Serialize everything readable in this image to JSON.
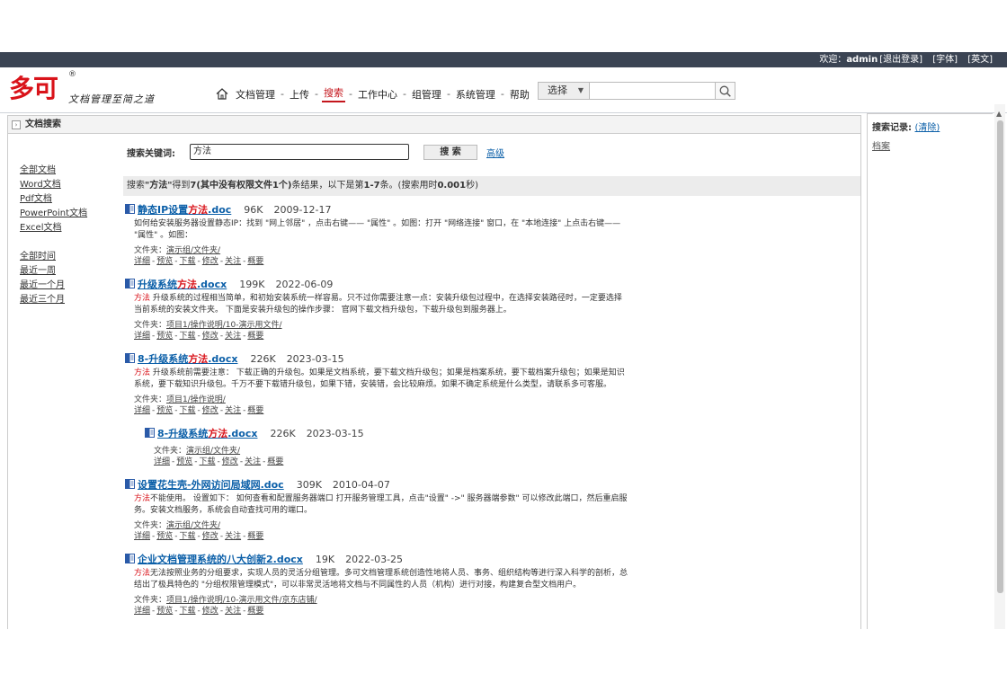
{
  "topbar": {
    "welcome": "欢迎：",
    "user": "admin",
    "logout": "[退出登录]",
    "font": "[字体]",
    "lang": "[英文]"
  },
  "logo": {
    "mark": "多可",
    "reg": "®",
    "slogan": "文档管理至简之道"
  },
  "nav": {
    "items": [
      "文档管理",
      "上传",
      "搜索",
      "工作中心",
      "组管理",
      "系统管理",
      "帮助"
    ],
    "active": "搜索"
  },
  "header_search": {
    "select_label": "选择"
  },
  "panel": {
    "title": "文档搜索"
  },
  "filters": {
    "types": [
      "全部文档",
      "Word文档",
      "Pdf文档",
      "PowerPoint文档",
      "Excel文档"
    ],
    "times": [
      "全部时间",
      "最近一周",
      "最近一个月",
      "最近三个月"
    ]
  },
  "search": {
    "label": "搜索关键词:",
    "value": "方法",
    "button": "搜 索",
    "advanced": "高级"
  },
  "summary": {
    "p1": "搜索",
    "kw": "\"方法\"",
    "p2": "得到",
    "count": "7(其中没有权限文件1个)",
    "p3": "条结果，以下是第",
    "range": "1-7",
    "p4": "条。(搜索用时",
    "time": "0.001",
    "p5": "秒)"
  },
  "results": [
    {
      "title_pre": "静态IP设置",
      "title_hl": "方法",
      "title_post": ".doc",
      "size": "96K",
      "date": "2009-12-17",
      "snippet_hl": "",
      "snippet": "如何给安装服务器设置静态IP：找到 \"网上邻居\" ，点击右键—— \"属性\" 。如图：打开 \"网络连接\" 窗口，在 \"本地连接\" 上点击右键—— \"属性\" 。如图：",
      "folder_label": "文件夹：",
      "folder": "演示组/文件夹/"
    },
    {
      "title_pre": "升级系统",
      "title_hl": "方法",
      "title_post": ".docx",
      "size": "199K",
      "date": "2022-06-09",
      "snippet_hl": "方法",
      "snippet": " 升级系统的过程相当简单，和初始安装系统一样容易。只不过你需要注意一点：安装升级包过程中，在选择安装路径时，一定要选择当前系统的安装文件夹。 下面是安装升级包的操作步骤： 官网下载文档升级包，下载升级包到服务器上。",
      "folder_label": "文件夹：",
      "folder": "项目1/操作说明/10-演示用文件/"
    },
    {
      "title_pre": "8-升级系统",
      "title_hl": "方法",
      "title_post": ".docx",
      "size": "226K",
      "date": "2023-03-15",
      "snippet_hl": "方法",
      "snippet": " 升级系统前需要注意： 下载正确的升级包。如果是文档系统，要下载文档升级包；如果是档案系统，要下载档案升级包；如果是知识系统，要下载知识升级包。千万不要下载错升级包，如果下错，安装错，会比较麻烦。如果不确定系统是什么类型，请联系多可客服。",
      "folder_label": "文件夹：",
      "folder": "项目1/操作说明/"
    },
    {
      "sub": true,
      "title_pre": "8-升级系统",
      "title_hl": "方法",
      "title_post": ".docx",
      "size": "226K",
      "date": "2023-03-15",
      "snippet_hl": "",
      "snippet": "",
      "folder_label": "文件夹：",
      "folder": "演示组/文件夹/"
    },
    {
      "title_pre": "设置花生壳-外网访问局域网.doc",
      "title_hl": "",
      "title_post": "",
      "size": "309K",
      "date": "2010-04-07",
      "snippet_hl": "方法",
      "snippet": "不能使用。 设置如下： 如何查看和配置服务器端口 打开服务管理工具，点击\"设置\" ->\" 服务器端参数\" 可以修改此端口，然后重启服务。安装文档服务，系统会自动查找可用的端口。",
      "folder_label": "文件夹：",
      "folder": "演示组/文件夹/"
    },
    {
      "title_pre": "企业文档管理系统的八大创新2.docx",
      "title_hl": "",
      "title_post": "",
      "size": "19K",
      "date": "2022-03-25",
      "snippet_hl": "方法",
      "snippet": "无法按照业务的分组要求，实现人员的灵活分组管理。多可文档管理系统创造性地将人员、事务、组织结构等进行深入科学的剖析，总结出了极具特色的 \"分组权限管理模式\"，可以非常灵活地将文档与不同属性的人员（机构）进行对接，构建复合型文档用户。",
      "folder_label": "文件夹：",
      "folder": "项目1/操作说明/10-演示用文件/京东店铺/"
    }
  ],
  "actions": [
    "详细",
    "预览",
    "下载",
    "修改",
    "关注",
    "概要"
  ],
  "right": {
    "title": "搜索记录:",
    "clear": "(清除)",
    "history": [
      "档案"
    ]
  },
  "colors": {
    "brand": "#d9131a",
    "link": "#0b5fa8",
    "topbar": "#3b4453"
  }
}
